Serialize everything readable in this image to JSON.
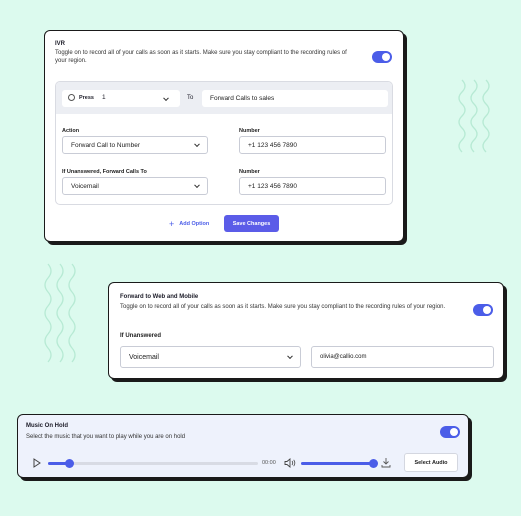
{
  "ivr": {
    "title": "IVR",
    "description": "Toggle on to record all of your calls as soon as it starts. Make sure you stay compliant to the recording rules of your region.",
    "press_label": "Press",
    "press_value": "1",
    "to_label": "To",
    "to_value": "Forward Calls to sales",
    "action_label": "Action",
    "action_value": "Forward Call to Number",
    "number_label_1": "Number",
    "number_value_1": "+1 123 456 7890",
    "unanswered_label": "If Unanswered, Forward Calls To",
    "unanswered_value": "Voicemail",
    "number_label_2": "Number",
    "number_value_2": "+1 123 456 7890",
    "add_option_label": "Add Option",
    "save_label": "Save Changes"
  },
  "forward": {
    "title": "Forward to Web and Mobile",
    "description": "Toggle on to record all of your calls as soon as it starts. Make sure you stay compliant to the recording rules of your region.",
    "unanswered_label": "If Unanswered",
    "select_value": "Voicemail",
    "email_value": "olivia@callio.com"
  },
  "music": {
    "title": "Music On Hold",
    "description": "Select the music that you want to play while you are on hold",
    "time": "00:00",
    "progress": 0.1,
    "volume": 0.96,
    "select_audio_label": "Select Audio"
  },
  "colors": {
    "accent": "#4b5de8",
    "background": "#dcfaee"
  }
}
